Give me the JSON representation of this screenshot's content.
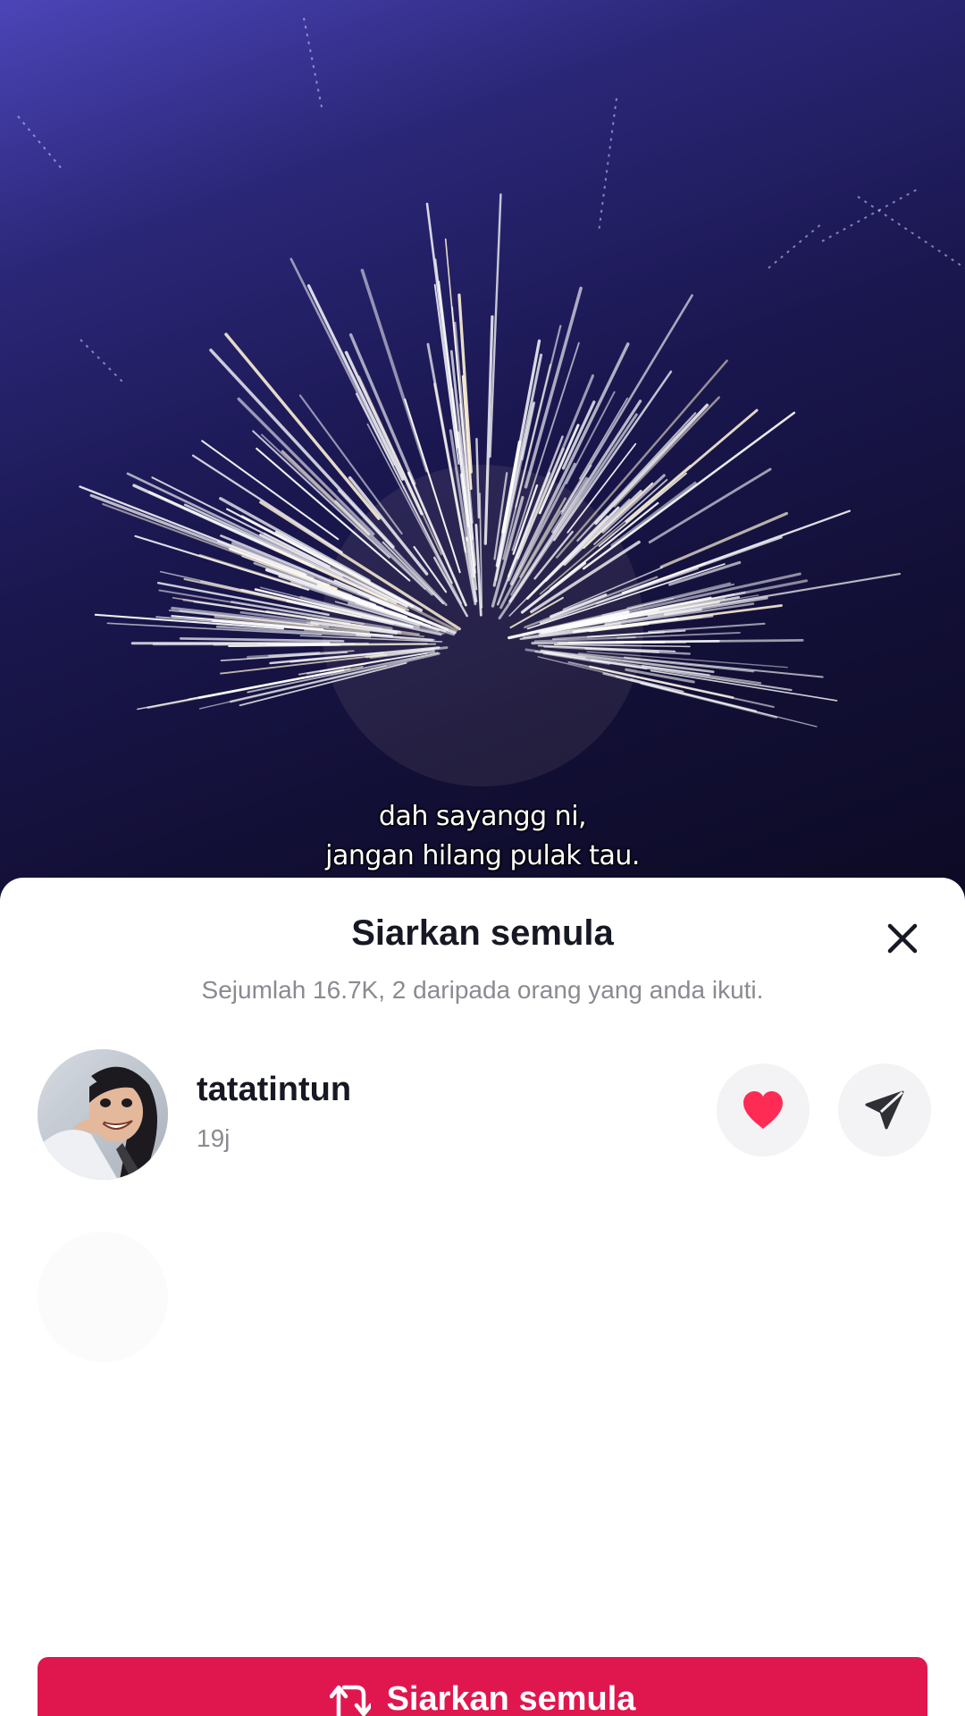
{
  "video": {
    "caption_line1": "dah sayangg ni,",
    "caption_line2": "jangan hilang pulak tau."
  },
  "sheet": {
    "title": "Siarkan semula",
    "subtitle": "Sejumlah 16.7K, 2 daripada orang yang anda ikuti.",
    "close_icon": "close-icon"
  },
  "reposter": {
    "username": "tatatintun",
    "time": "19j",
    "like_icon": "heart-icon",
    "send_icon": "send-icon"
  },
  "action": {
    "repost_label": "Siarkan semula",
    "repost_icon": "repost-icon"
  },
  "colors": {
    "accent": "#e0174f",
    "heart": "#fe2c55",
    "text_primary": "#161823",
    "text_secondary": "#8a8b91",
    "button_bg": "#f3f3f5"
  }
}
